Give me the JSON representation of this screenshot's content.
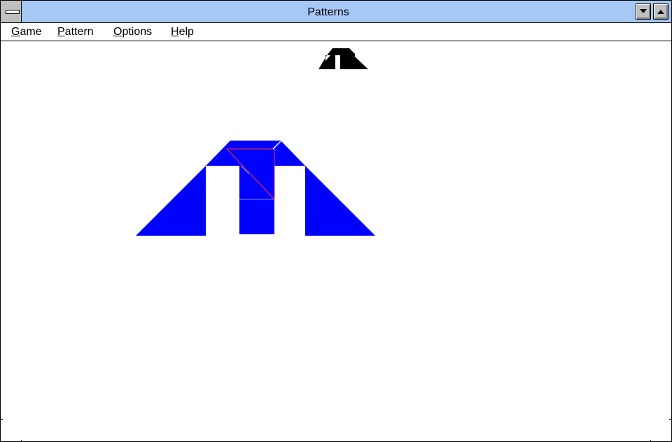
{
  "window": {
    "title": "Patterns"
  },
  "menu": [
    {
      "label": "Game",
      "underline": "G",
      "rest": "ame"
    },
    {
      "label": "Pattern",
      "underline": "P",
      "rest": "attern"
    },
    {
      "label": "Options",
      "underline": "O",
      "rest": "ptions"
    },
    {
      "label": "Help",
      "underline": "H",
      "rest": "elp"
    }
  ],
  "colors": {
    "titlebar": "#a6c8f5",
    "piece_fill": "#0000ff",
    "piece_outline": "#ff0000",
    "target_pattern": "#000000"
  },
  "icons": {
    "system_menu": "system-menu-icon",
    "minimize": "minimize-arrow-icon",
    "maximize": "maximize-arrow-icon"
  }
}
